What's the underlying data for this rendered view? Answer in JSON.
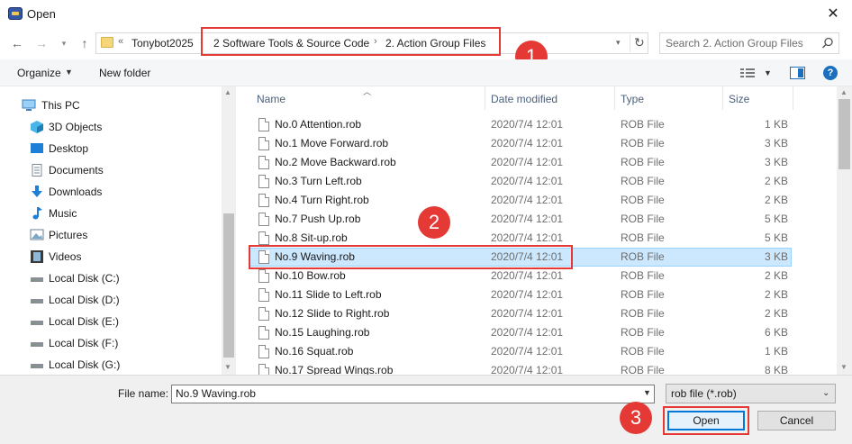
{
  "window": {
    "title": "Open"
  },
  "address": {
    "overflow": "«",
    "crumbs": [
      "Tonybot2025",
      "2 Software Tools & Source Code",
      "2. Action Group Files"
    ],
    "search_placeholder": "Search 2. Action Group Files"
  },
  "toolbar": {
    "organize": "Organize",
    "new_folder": "New folder"
  },
  "annotations": {
    "badge1": "1",
    "badge2": "2",
    "badge3": "3",
    "color": "#e53935"
  },
  "sidebar": {
    "items": [
      {
        "label": "This PC",
        "icon": "computer-icon"
      },
      {
        "label": "3D Objects",
        "icon": "cube-icon"
      },
      {
        "label": "Desktop",
        "icon": "desktop-icon"
      },
      {
        "label": "Documents",
        "icon": "documents-icon"
      },
      {
        "label": "Downloads",
        "icon": "download-arrow-icon"
      },
      {
        "label": "Music",
        "icon": "music-note-icon"
      },
      {
        "label": "Pictures",
        "icon": "pictures-icon"
      },
      {
        "label": "Videos",
        "icon": "film-icon"
      },
      {
        "label": "Local Disk (C:)",
        "icon": "drive-icon"
      },
      {
        "label": "Local Disk (D:)",
        "icon": "drive-icon"
      },
      {
        "label": "Local Disk (E:)",
        "icon": "drive-icon"
      },
      {
        "label": "Local Disk (F:)",
        "icon": "drive-icon"
      },
      {
        "label": "Local Disk (G:)",
        "icon": "drive-icon"
      }
    ]
  },
  "columns": {
    "name": "Name",
    "date": "Date modified",
    "type": "Type",
    "size": "Size"
  },
  "files": [
    {
      "name": "No.0 Attention.rob",
      "date": "2020/7/4 12:01",
      "type": "ROB File",
      "size": "1 KB"
    },
    {
      "name": "No.1 Move Forward.rob",
      "date": "2020/7/4 12:01",
      "type": "ROB File",
      "size": "3 KB"
    },
    {
      "name": "No.2 Move Backward.rob",
      "date": "2020/7/4 12:01",
      "type": "ROB File",
      "size": "3 KB"
    },
    {
      "name": "No.3 Turn Left.rob",
      "date": "2020/7/4 12:01",
      "type": "ROB File",
      "size": "2 KB"
    },
    {
      "name": "No.4 Turn Right.rob",
      "date": "2020/7/4 12:01",
      "type": "ROB File",
      "size": "2 KB"
    },
    {
      "name": "No.7 Push Up.rob",
      "date": "2020/7/4 12:01",
      "type": "ROB File",
      "size": "5 KB"
    },
    {
      "name": "No.8 Sit-up.rob",
      "date": "2020/7/4 12:01",
      "type": "ROB File",
      "size": "5 KB"
    },
    {
      "name": "No.9 Waving.rob",
      "date": "2020/7/4 12:01",
      "type": "ROB File",
      "size": "3 KB",
      "selected": true
    },
    {
      "name": "No.10 Bow.rob",
      "date": "2020/7/4 12:01",
      "type": "ROB File",
      "size": "2 KB"
    },
    {
      "name": "No.11 Slide to Left.rob",
      "date": "2020/7/4 12:01",
      "type": "ROB File",
      "size": "2 KB"
    },
    {
      "name": "No.12 Slide to Right.rob",
      "date": "2020/7/4 12:01",
      "type": "ROB File",
      "size": "2 KB"
    },
    {
      "name": "No.15 Laughing.rob",
      "date": "2020/7/4 12:01",
      "type": "ROB File",
      "size": "6 KB"
    },
    {
      "name": "No.16 Squat.rob",
      "date": "2020/7/4 12:01",
      "type": "ROB File",
      "size": "1 KB"
    },
    {
      "name": "No.17 Spread Wings.rob",
      "date": "2020/7/4 12:01",
      "type": "ROB File",
      "size": "8 KB"
    }
  ],
  "footer": {
    "file_name_label": "File name:",
    "file_name_value": "No.9 Waving.rob",
    "file_type_value": "rob file (*.rob)",
    "open_label": "Open",
    "cancel_label": "Cancel"
  }
}
